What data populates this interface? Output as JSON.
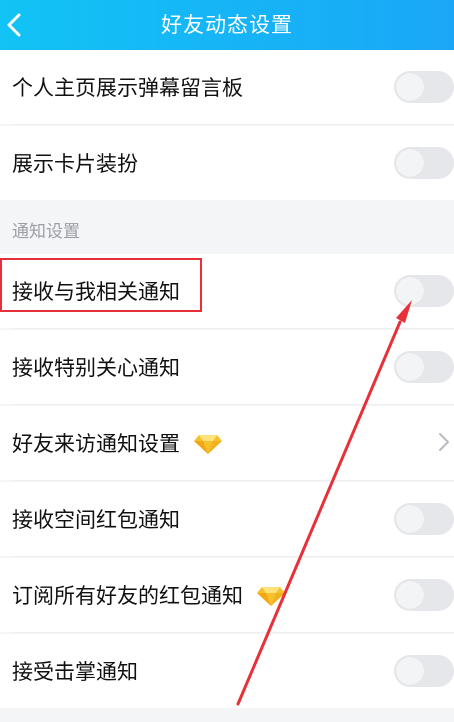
{
  "header": {
    "title": "好友动态设置"
  },
  "rows_top": [
    {
      "label": "个人主页展示弹幕留言板",
      "control": "toggle",
      "state": "off"
    },
    {
      "label": "展示卡片装扮",
      "control": "toggle",
      "state": "off"
    }
  ],
  "section": {
    "label": "通知设置"
  },
  "rows_notify": [
    {
      "label": "接收与我相关通知",
      "control": "toggle",
      "state": "off"
    },
    {
      "label": "接收特别关心通知",
      "control": "toggle",
      "state": "off"
    },
    {
      "label": "好友来访通知设置",
      "control": "chevron",
      "icon": "diamond-icon"
    },
    {
      "label": "接收空间红包通知",
      "control": "toggle",
      "state": "off"
    },
    {
      "label": "订阅所有好友的红包通知",
      "control": "toggle",
      "state": "off",
      "icon": "diamond-icon"
    },
    {
      "label": "接受击掌通知",
      "control": "toggle",
      "state": "off"
    }
  ],
  "colors": {
    "header_start": "#12c3f5",
    "header_end": "#1aa7f7",
    "highlight": "#e7313a",
    "arrow": "#e7313a",
    "gem_yellow": "#f7c12e"
  }
}
